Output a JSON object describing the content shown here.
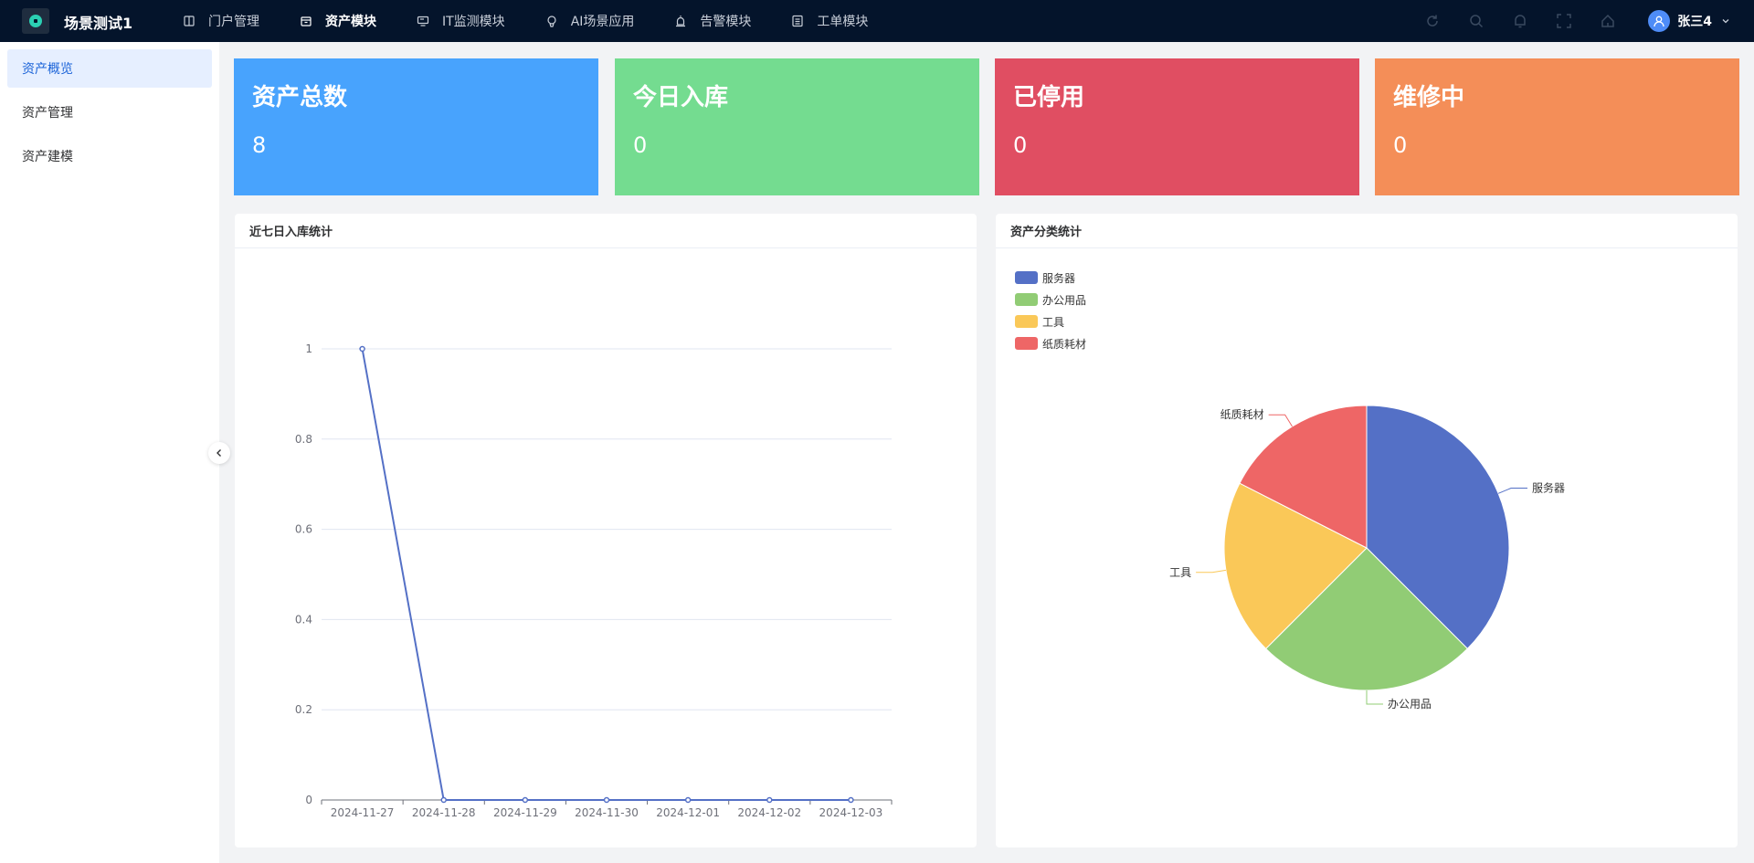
{
  "header": {
    "app_title": "场景测试1",
    "nav": [
      {
        "label": "门户管理",
        "icon": "book-icon",
        "active": false
      },
      {
        "label": "资产模块",
        "icon": "box-icon",
        "active": true
      },
      {
        "label": "IT监测模块",
        "icon": "monitor-icon",
        "active": false
      },
      {
        "label": "AI场景应用",
        "icon": "bulb-icon",
        "active": false
      },
      {
        "label": "告警模块",
        "icon": "alarm-icon",
        "active": false
      },
      {
        "label": "工单模块",
        "icon": "list-icon",
        "active": false
      }
    ],
    "tools": [
      "refresh-icon",
      "search-icon",
      "bell-icon",
      "fullscreen-icon",
      "home-icon"
    ],
    "user_name": "张三4"
  },
  "sidebar": {
    "items": [
      {
        "label": "资产概览",
        "active": true
      },
      {
        "label": "资产管理",
        "active": false
      },
      {
        "label": "资产建模",
        "active": false
      }
    ]
  },
  "stats": [
    {
      "title": "资产总数",
      "value": "8",
      "color": "#48a3fd"
    },
    {
      "title": "今日入库",
      "value": "0",
      "color": "#74dc90"
    },
    {
      "title": "已停用",
      "value": "0",
      "color": "#e04e62"
    },
    {
      "title": "维修中",
      "value": "0",
      "color": "#f48e58"
    }
  ],
  "line_panel": {
    "title": "近七日入库统计"
  },
  "pie_panel": {
    "title": "资产分类统计"
  },
  "chart_data": [
    {
      "type": "line",
      "categories": [
        "2024-11-27",
        "2024-11-28",
        "2024-11-29",
        "2024-11-30",
        "2024-12-01",
        "2024-12-02",
        "2024-12-03"
      ],
      "values": [
        1,
        0,
        0,
        0,
        0,
        0,
        0
      ],
      "yticks": [
        "0",
        "0.2",
        "0.4",
        "0.6",
        "0.8",
        "1"
      ],
      "ylim": [
        0,
        1
      ],
      "grid": true,
      "color": "#5470c6"
    },
    {
      "type": "pie",
      "slices": [
        {
          "name": "服务器",
          "value": 3,
          "color": "#5470c6"
        },
        {
          "name": "办公用品",
          "value": 2,
          "color": "#91cc75"
        },
        {
          "name": "工具",
          "value": 1.6,
          "color": "#fac858"
        },
        {
          "name": "纸质耗材",
          "value": 1.4,
          "color": "#ee6666"
        }
      ],
      "legend_position": "top-left"
    }
  ]
}
